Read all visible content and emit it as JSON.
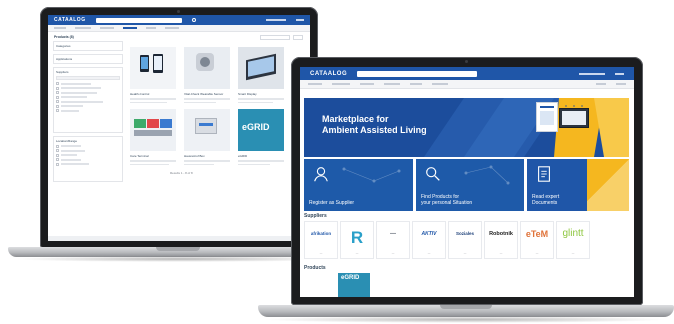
{
  "brand": "CATAALOG",
  "back_laptop": {
    "page_heading": "Products (8)",
    "filters": [
      "Categories",
      "Applications",
      "Suppliers",
      "Location/Range"
    ],
    "products": [
      {
        "title": "Health-Control"
      },
      {
        "title": "Vital-Check Wearable Sensor"
      },
      {
        "title": "Smart Display"
      },
      {
        "title": "Care Terminal"
      },
      {
        "title": "Hausnotruf Box"
      },
      {
        "title": "eGRID"
      }
    ],
    "product_logo_text": "eGRID",
    "pager": "Results 1 - 8 of 8"
  },
  "front_laptop": {
    "hero": {
      "line1": "Marketplace for",
      "line2": "Ambient Assisted Living"
    },
    "cards": [
      {
        "label": "Register as Supplier"
      },
      {
        "label_line1": "Find Products for",
        "label_line2": "your personal Situation"
      },
      {
        "label_line1": "Read expert",
        "label_line2": "Documents"
      }
    ],
    "suppliers_heading": "Suppliers",
    "suppliers": [
      {
        "logo": "afrikation"
      },
      {
        "logo": "R"
      },
      {
        "logo": "—"
      },
      {
        "logo": "AKTIV"
      },
      {
        "logo": "Soziales"
      },
      {
        "logo": "Robotnik"
      },
      {
        "logo": "eTeM"
      },
      {
        "logo": "glintt"
      }
    ],
    "products_heading": "Products",
    "products_logo": "eGRID"
  },
  "colors": {
    "brand_blue": "#1f56a8",
    "accent_yellow": "#f5b71f",
    "accent_green": "#8dc63f"
  }
}
